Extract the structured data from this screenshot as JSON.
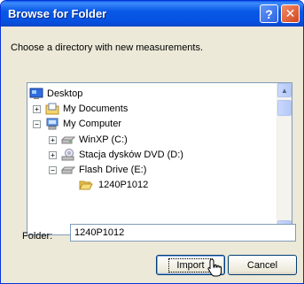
{
  "window": {
    "title": "Browse for Folder"
  },
  "prompt": "Choose a directory with new measurements.",
  "tree": {
    "items": [
      {
        "label": "Desktop",
        "expander": "",
        "icon": "desktop-icon",
        "depth": 0
      },
      {
        "label": "My Documents",
        "expander": "+",
        "icon": "my-documents-icon",
        "depth": 1
      },
      {
        "label": "My Computer",
        "expander": "−",
        "icon": "my-computer-icon",
        "depth": 1
      },
      {
        "label": "WinXP (C:)",
        "expander": "+",
        "icon": "hard-drive-icon",
        "depth": 2
      },
      {
        "label": "Stacja dysków DVD (D:)",
        "expander": "+",
        "icon": "dvd-drive-icon",
        "depth": 2
      },
      {
        "label": "Flash Drive (E:)",
        "expander": "−",
        "icon": "flash-drive-icon",
        "depth": 2
      },
      {
        "label": "1240P1012",
        "expander": "",
        "icon": "open-folder-icon",
        "depth": 3,
        "selected": true
      }
    ]
  },
  "folder": {
    "label": "Folder:",
    "value": "1240P1012"
  },
  "buttons": {
    "import": "Import",
    "cancel": "Cancel"
  },
  "colors": {
    "titlebar": "#0a5fe8",
    "dialog_bg": "#ece9d8",
    "selection": "#316ac5"
  }
}
